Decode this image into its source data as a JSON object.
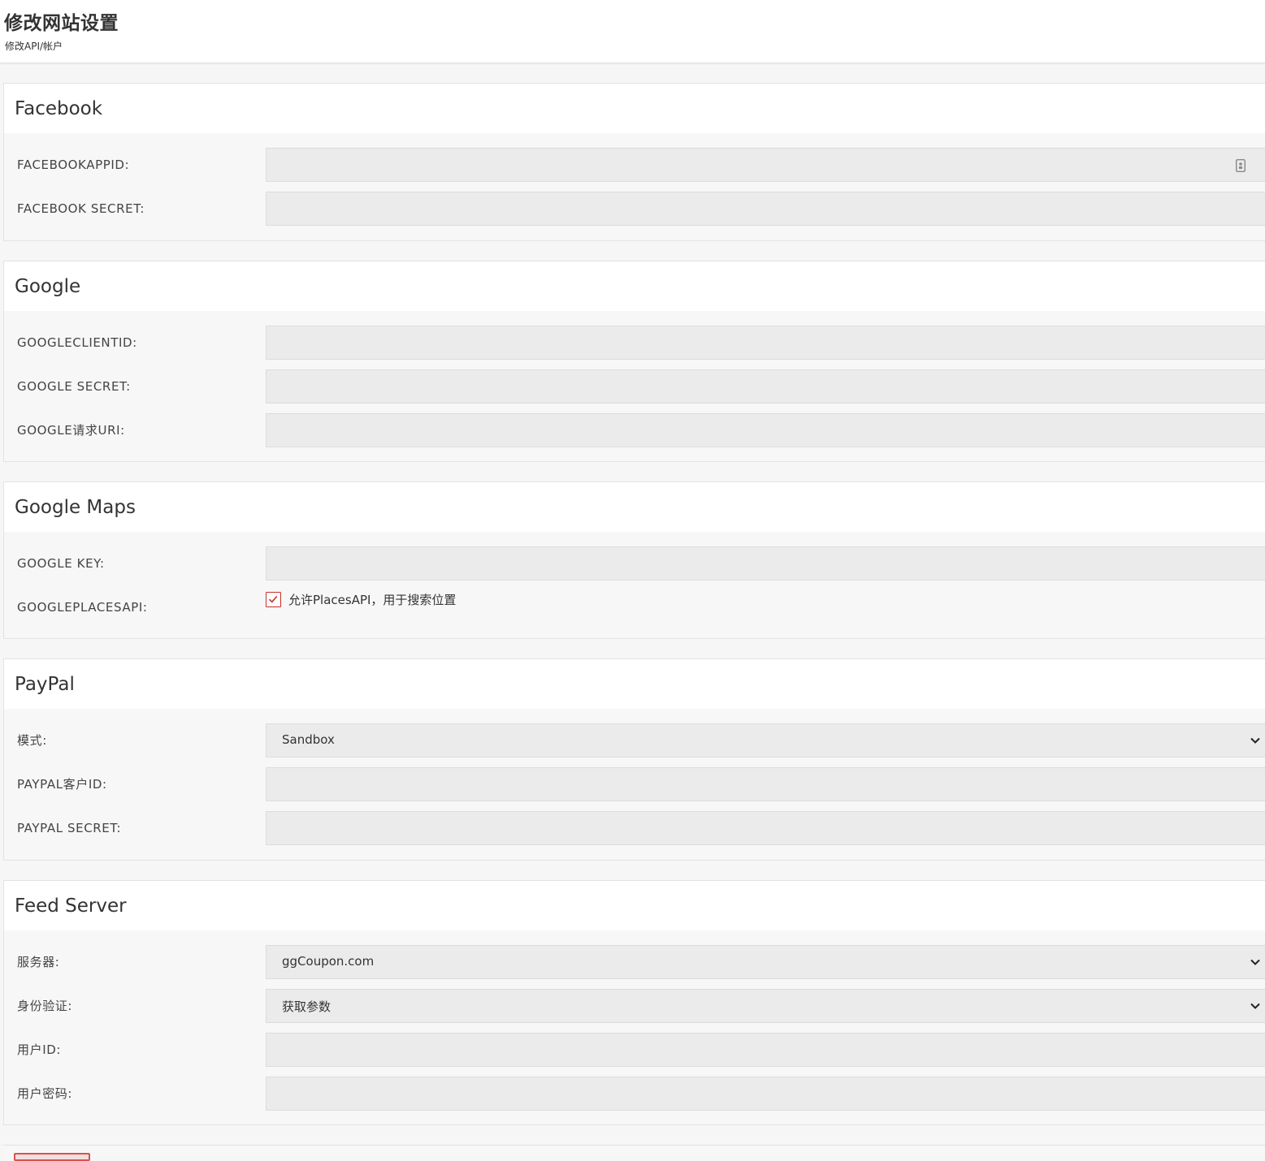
{
  "header": {
    "title": "修改网站设置",
    "subtitle": "修改API/帐户"
  },
  "colors": {
    "accent": "#c9302c",
    "field_bg": "#ecebeb",
    "panel_bg": "#f7f7f7"
  },
  "sections": {
    "facebook": {
      "title": "Facebook",
      "app_id_label": "FACEBOOKAPPID:",
      "app_id_value": "",
      "secret_label": "FACEBOOK SECRET:",
      "secret_value": ""
    },
    "google": {
      "title": "Google",
      "client_id_label": "GOOGLECLIENTID:",
      "client_id_value": "",
      "secret_label": "GOOGLE SECRET:",
      "secret_value": "",
      "redirect_uri_label": "GOOGLE请求URI:",
      "redirect_uri_value": ""
    },
    "google_maps": {
      "title": "Google Maps",
      "key_label": "GOOGLE KEY:",
      "key_value": "",
      "places_api_label": "GOOGLEPLACESAPI:",
      "places_api_checkbox_label": "允许PlacesAPI，用于搜索位置",
      "places_api_checked": true
    },
    "paypal": {
      "title": "PayPal",
      "mode_label": "模式:",
      "mode_value": "Sandbox",
      "client_id_label": "PAYPAL客户ID:",
      "client_id_value": "",
      "secret_label": "PAYPAL SECRET:",
      "secret_value": ""
    },
    "feed_server": {
      "title": "Feed Server",
      "server_label": "服务器:",
      "server_value": "ggCoupon.com",
      "auth_label": "身份验证:",
      "auth_value": "获取参数",
      "user_id_label": "用户ID:",
      "user_id_value": "",
      "password_label": "用户密码:",
      "password_value": ""
    }
  },
  "icons": {
    "password_manager": "key-icon",
    "dropdown": "chevron-down-icon",
    "checkbox": "check-icon"
  }
}
